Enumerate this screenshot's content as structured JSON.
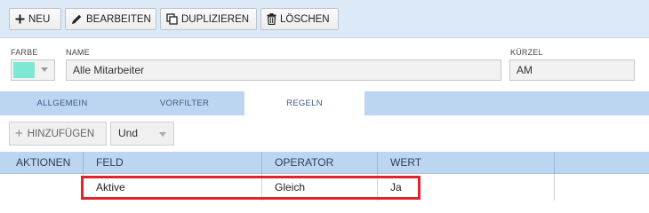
{
  "toolbar": {
    "new_label": "NEU",
    "edit_label": "BEARBEITEN",
    "duplicate_label": "DUPLIZIEREN",
    "delete_label": "LÖSCHEN"
  },
  "form": {
    "color_label": "FARBE",
    "color_value": "#7fe8d4",
    "name_label": "NAME",
    "name_value": "Alle Mitarbeiter",
    "abbr_label": "KÜRZEL",
    "abbr_value": "AM"
  },
  "tabs": [
    {
      "label": "ALLGEMEIN",
      "active": false
    },
    {
      "label": "VORFILTER",
      "active": false
    },
    {
      "label": "REGELN",
      "active": true
    }
  ],
  "rules": {
    "add_label": "HINZUFÜGEN",
    "logic_select": "Und"
  },
  "table": {
    "columns": [
      "AKTIONEN",
      "FELD",
      "OPERATOR",
      "WERT"
    ],
    "rows": [
      {
        "aktionen": "",
        "feld": "Aktive",
        "operator": "Gleich",
        "wert": "Ja"
      }
    ]
  },
  "colors": {
    "toolbar_bg": "#dce9f7",
    "tab_bar_bg": "#bcd6f1",
    "highlight": "#e0242c"
  }
}
